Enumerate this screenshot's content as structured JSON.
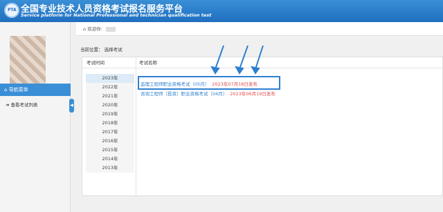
{
  "header": {
    "logo_text": "PTA",
    "title": "全国专业技术人员资格考试报名服务平台",
    "subtitle": "Service platform for National Professional and technician qualification test"
  },
  "sidebar": {
    "nav_header": "导航菜单",
    "items": [
      {
        "label": "查看考试列表"
      }
    ]
  },
  "welcome": {
    "label": "欢迎你:"
  },
  "breadcrumb": {
    "label": "当前位置：  选择考试"
  },
  "table": {
    "year_header": "考试时间",
    "name_header": "考试名称",
    "years": [
      "2023年",
      "2022年",
      "2021年",
      "2020年",
      "2019年",
      "2018年",
      "2017年",
      "2016年",
      "2015年",
      "2014年",
      "2013年"
    ],
    "selected_year": "2023年",
    "exams": [
      {
        "name": "监理工程师职业资格考试（05月）",
        "date": "2023年07月18日发布"
      },
      {
        "name": "咨询工程师（投资）职业资格考试（04月）",
        "date": "2023年06月19日发布"
      }
    ]
  },
  "colors": {
    "accent": "#2f7fd0",
    "date_red": "#e34b4b",
    "annotation_arrow": "#2f7fd0"
  }
}
